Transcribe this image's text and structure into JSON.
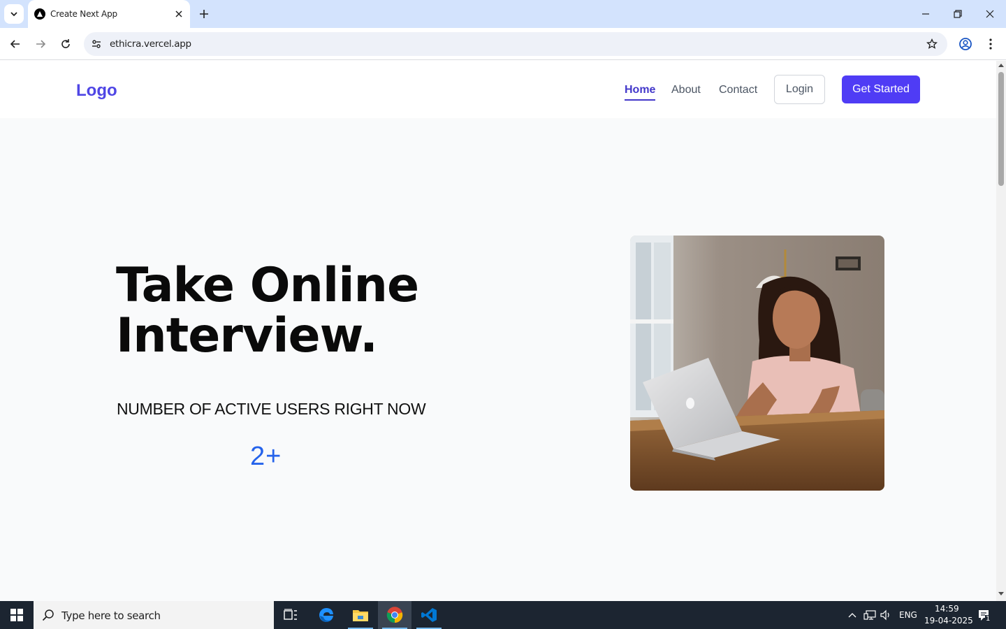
{
  "browser": {
    "tab_title": "Create Next App",
    "url": "ethicra.vercel.app"
  },
  "site": {
    "logo": "Logo",
    "nav": [
      {
        "label": "Home",
        "active": true
      },
      {
        "label": "About",
        "active": false
      },
      {
        "label": "Contact",
        "active": false
      }
    ],
    "login_label": "Login",
    "get_started_label": "Get Started",
    "hero": {
      "title_line1": "Take Online",
      "title_line2": "Interview.",
      "active_users_label": "NUMBER OF ACTIVE USERS RIGHT NOW",
      "active_users_count": "2+"
    },
    "colors": {
      "brand": "#4f46e5",
      "button": "#4f3cf5",
      "count": "#2563eb"
    }
  },
  "taskbar": {
    "search_placeholder": "Type here to search",
    "language": "ENG",
    "time": "14:59",
    "date": "19-04-2025",
    "notification_count": "1",
    "apps": [
      "task-view-icon",
      "edge-icon",
      "file-explorer-icon",
      "chrome-icon",
      "vscode-icon"
    ]
  }
}
